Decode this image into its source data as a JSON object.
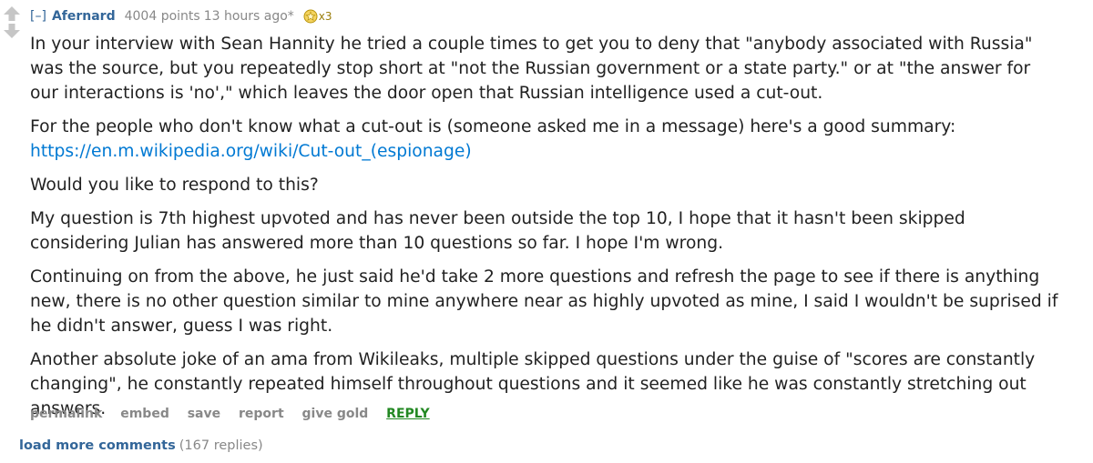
{
  "comment": {
    "expand_label": "[–]",
    "author": "Afernard",
    "score": "4004 points",
    "time": "13 hours ago",
    "edited_mark": "*",
    "gold_count": "x3",
    "paragraphs": [
      "In your interview with Sean Hannity he tried a couple times to get you to deny that \"anybody associated with Russia\" was the source, but you repeatedly stop short at \"not the Russian government or a state party.\" or at \"the answer for our interactions is 'no',\" which leaves the door open that Russian intelligence used a cut-out.",
      "For the people who don't know what a cut-out is (someone asked me in a message) here's a good summary:",
      "Would you like to respond to this?",
      "My question is 7th highest upvoted and has never been outside the top 10, I hope that it hasn't been skipped considering Julian has answered more than 10 questions so far. I hope I'm wrong.",
      "Continuing on from the above, he just said he'd take 2 more questions and refresh the page to see if there is anything new, there is no other question similar to mine anywhere near as highly upvoted as mine, I said I wouldn't be suprised if he didn't answer, guess I was right.",
      "Another absolute joke of an ama from Wikileaks, multiple skipped questions under the guise of \"scores are constantly changing\", he constantly repeated himself throughout questions and it seemed like he was constantly stretching out answers."
    ],
    "link": "https://en.m.wikipedia.org/wiki/Cut-out_(espionage)",
    "buttons": {
      "permalink": "permalink",
      "embed": "embed",
      "save": "save",
      "report": "report",
      "give_gold": "give gold",
      "reply": "REPLY"
    }
  },
  "load_more": {
    "label": "load more comments",
    "count": "(167 replies)"
  },
  "icons": {
    "upvote": "upvote-arrow-icon",
    "downvote": "downvote-arrow-icon",
    "gold": "gold-award-icon"
  },
  "colors": {
    "link": "#0079d3",
    "author": "#336699",
    "meta": "#888888",
    "reply": "#228822"
  }
}
